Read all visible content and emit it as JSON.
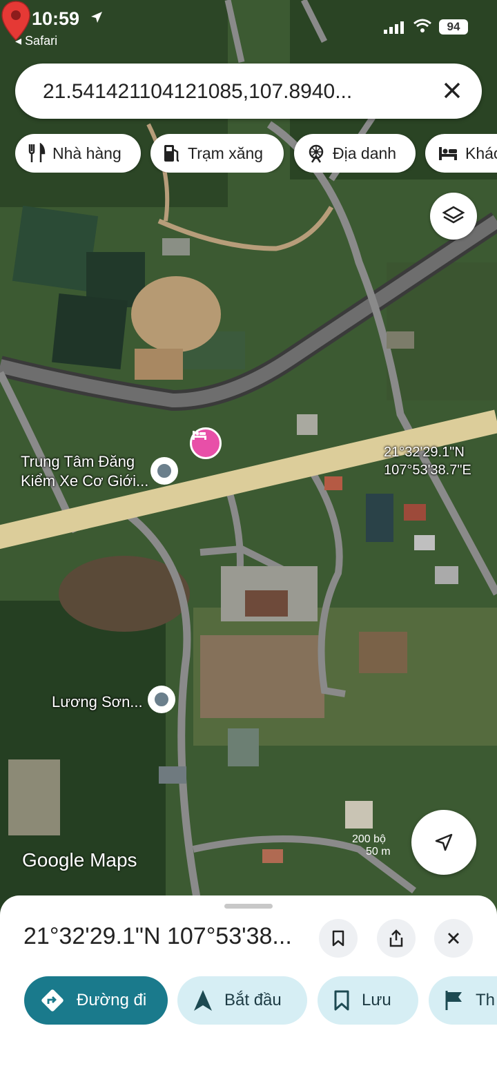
{
  "status_bar": {
    "time": "10:59",
    "back_app": "Safari",
    "battery": "94"
  },
  "search": {
    "query": "21.541421104121085,107.8940..."
  },
  "chips": [
    {
      "label": "Nhà hàng",
      "icon": "restaurant-icon"
    },
    {
      "label": "Trạm xăng",
      "icon": "gas-station-icon"
    },
    {
      "label": "Địa danh",
      "icon": "landmark-icon"
    },
    {
      "label": "Khác",
      "icon": "hotel-bed-icon"
    }
  ],
  "map": {
    "labels": {
      "trung_tam_line1": "Trung Tâm Đăng",
      "trung_tam_line2": "Kiểm Xe Cơ Giới...",
      "luong_son": "Lương Sơn..."
    },
    "pin": {
      "lat": "21°32'29.1\"N",
      "lng": "107°53'38.7\"E"
    },
    "logo": "Google Maps",
    "scale": {
      "imperial": "200 bộ",
      "metric": "50 m"
    }
  },
  "sheet": {
    "title": "21°32'29.1\"N 107°53'38...",
    "actions": [
      {
        "label": "Đường đi",
        "icon": "directions-icon"
      },
      {
        "label": "Bắt đầu",
        "icon": "navigation-arrow-icon"
      },
      {
        "label": "Lưu",
        "icon": "bookmark-icon"
      },
      {
        "label": "Th",
        "icon": "flag-icon"
      }
    ]
  },
  "colors": {
    "accent": "#1a7a8c",
    "chip_bg": "#d6eef4",
    "pin": "#e53935",
    "hotel": "#e84fa8"
  }
}
